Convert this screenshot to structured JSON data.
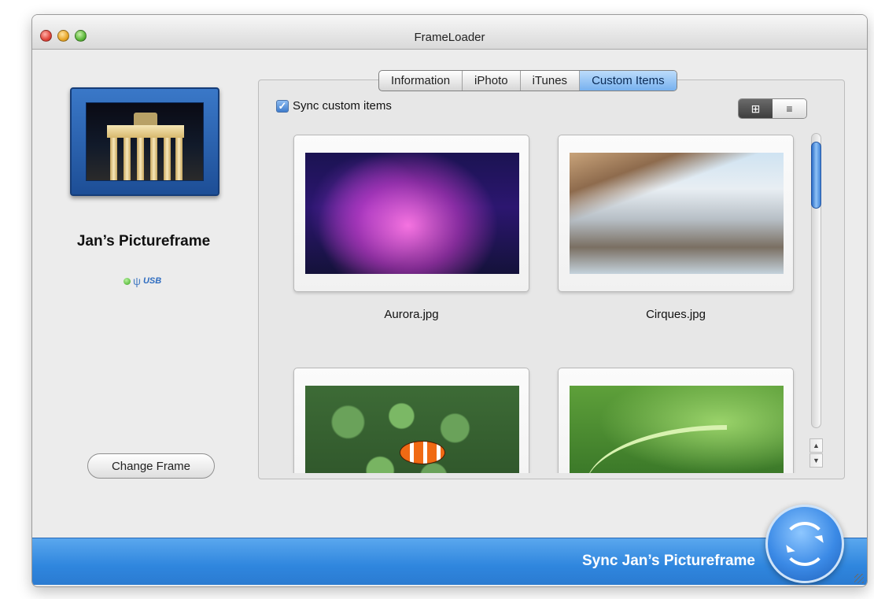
{
  "window": {
    "title": "FrameLoader"
  },
  "device": {
    "name": "Jan’s Pictureframe",
    "connection": "USB",
    "usb_glyph": "ψ"
  },
  "left": {
    "change_frame_label": "Change Frame"
  },
  "tabs": [
    {
      "label": "Information",
      "selected": false
    },
    {
      "label": "iPhoto",
      "selected": false
    },
    {
      "label": "iTunes",
      "selected": false
    },
    {
      "label": "Custom Items",
      "selected": true
    }
  ],
  "sync_custom": {
    "label": "Sync custom items",
    "checked": true
  },
  "view_toggle": {
    "grid_icon": "grid-view-icon",
    "list_icon": "list-view-icon",
    "active": "grid"
  },
  "items": [
    {
      "caption": "Aurora.jpg"
    },
    {
      "caption": "Cirques.jpg"
    },
    {
      "caption": ""
    },
    {
      "caption": ""
    }
  ],
  "bottom": {
    "sync_label": "Sync Jan’s Pictureframe"
  },
  "colors": {
    "accent": "#2f86de",
    "tab_selected": "#77b1ef"
  }
}
